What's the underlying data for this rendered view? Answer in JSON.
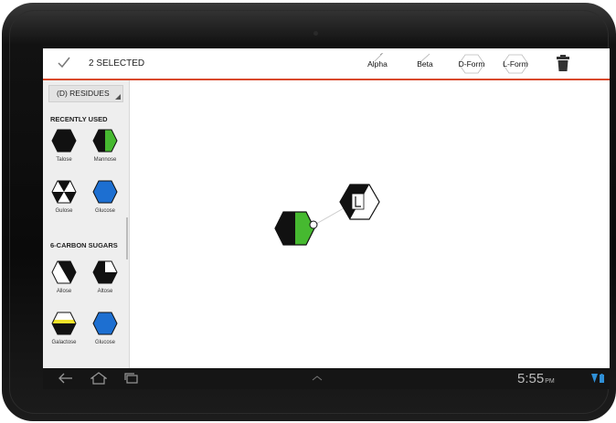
{
  "toolbar": {
    "selection_label": "2 SELECTED",
    "buttons": [
      {
        "label": "Alpha",
        "icon": "alpha-linkage-icon"
      },
      {
        "label": "Beta",
        "icon": "beta-linkage-icon"
      },
      {
        "label": "D-Form",
        "icon": "hexagon-outline-icon"
      },
      {
        "label": "L-Form",
        "icon": "hexagon-outline-icon"
      }
    ],
    "accent_color": "#d9492a"
  },
  "sidebar": {
    "dropdown_label": "(D) RESIDUES",
    "sections": [
      {
        "title": "RECENTLY USED",
        "items": [
          {
            "name": "Talose",
            "style": "solid-black"
          },
          {
            "name": "Mannose",
            "style": "black-green-split"
          },
          {
            "name": "Gulose",
            "style": "black-white-triangles"
          },
          {
            "name": "Glucose",
            "style": "solid-blue"
          }
        ]
      },
      {
        "title": "6-CARBON SUGARS",
        "items": [
          {
            "name": "Allose",
            "style": "white-black-diagonal"
          },
          {
            "name": "Altose",
            "style": "black-white-quarter"
          },
          {
            "name": "Galactose",
            "style": "yellow-black-band"
          },
          {
            "name": "Glucose",
            "style": "solid-blue"
          }
        ]
      }
    ]
  },
  "canvas": {
    "nodes": [
      {
        "style": "black-green-split",
        "selected": true
      },
      {
        "style": "black-white-diagonal",
        "badge": "L",
        "selected": true
      }
    ]
  },
  "navbar": {
    "clock": "5:55",
    "ampm": "PM",
    "icons": [
      "back-icon",
      "home-icon",
      "recent-apps-icon",
      "menu-up-icon",
      "wifi-icon",
      "battery-icon"
    ]
  },
  "colors": {
    "green": "#46b930",
    "blue": "#1d6fd1",
    "yellow": "#f0e32a",
    "black": "#111111"
  }
}
